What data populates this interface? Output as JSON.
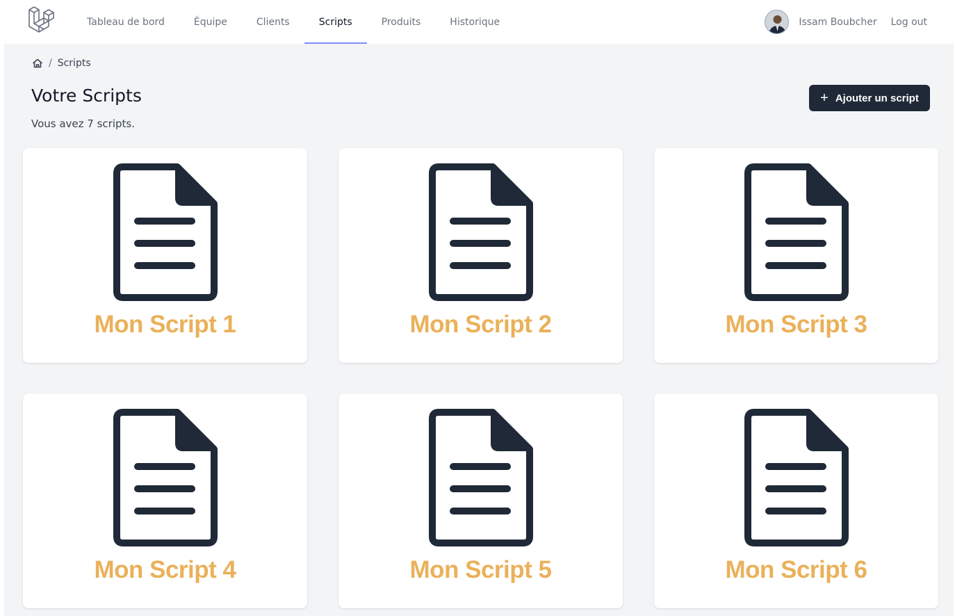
{
  "nav": {
    "links": [
      {
        "label": "Tableau de bord",
        "active": false
      },
      {
        "label": "Équipe",
        "active": false
      },
      {
        "label": "Clients",
        "active": false
      },
      {
        "label": "Scripts",
        "active": true
      },
      {
        "label": "Produits",
        "active": false
      },
      {
        "label": "Historique",
        "active": false
      }
    ],
    "user_name": "Issam Boubcher",
    "logout_label": "Log out"
  },
  "breadcrumb": {
    "separator": "/",
    "current": "Scripts"
  },
  "page": {
    "title": "Votre Scripts",
    "subtitle": "Vous avez 7 scripts.",
    "add_button_label": "Ajouter un script",
    "add_button_icon": "+"
  },
  "scripts": [
    {
      "title": "Mon Script 1"
    },
    {
      "title": "Mon Script 2"
    },
    {
      "title": "Mon Script 3"
    },
    {
      "title": "Mon Script 4"
    },
    {
      "title": "Mon Script 5"
    },
    {
      "title": "Mon Script 6"
    }
  ],
  "colors": {
    "accent": "#818cf8",
    "button_bg": "#1f2937",
    "card_title": "#eab15a",
    "icon": "#1f2937"
  }
}
